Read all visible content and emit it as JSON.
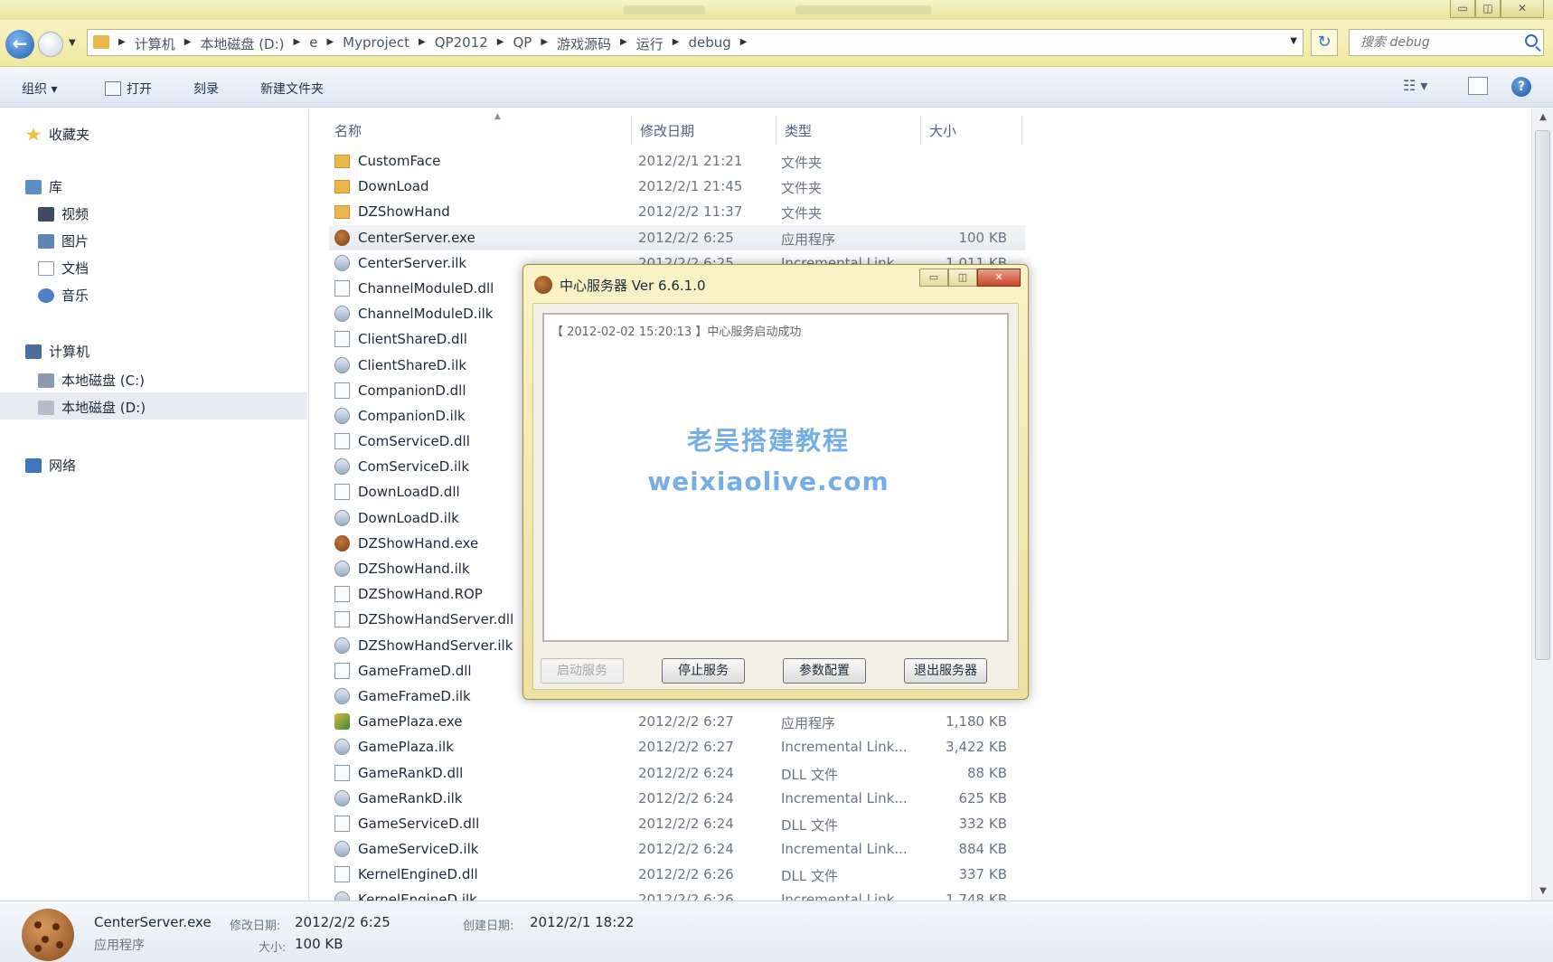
{
  "window": {
    "min": "▭",
    "max": "◫",
    "close": "✕"
  },
  "address": {
    "breadcrumbs": [
      "计算机",
      "本地磁盘 (D:)",
      "e",
      "Myproject",
      "QP2012",
      "QP",
      "游戏源码",
      "运行",
      "debug"
    ],
    "search_placeholder": "搜索 debug"
  },
  "toolbar": {
    "organize": "组织 ▾",
    "open": "打开",
    "burn": "刻录",
    "new_folder": "新建文件夹",
    "view": "☷ ▾",
    "help": "?"
  },
  "nav": {
    "favorites": "收藏夹",
    "libraries": "库",
    "lib_items": [
      "视频",
      "图片",
      "文档",
      "音乐"
    ],
    "computer": "计算机",
    "drives": [
      "本地磁盘 (C:)",
      "本地磁盘 (D:)"
    ],
    "network": "网络"
  },
  "columns": {
    "name": "名称",
    "date": "修改日期",
    "type": "类型",
    "size": "大小"
  },
  "files": [
    {
      "name": "CustomFace",
      "date": "2012/2/1 21:21",
      "type": "文件夹",
      "size": "",
      "icon": "folder-icon"
    },
    {
      "name": "DownLoad",
      "date": "2012/2/1 21:45",
      "type": "文件夹",
      "size": "",
      "icon": "folder-icon"
    },
    {
      "name": "DZShowHand",
      "date": "2012/2/2 11:37",
      "type": "文件夹",
      "size": "",
      "icon": "folder-icon"
    },
    {
      "name": "CenterServer.exe",
      "date": "2012/2/2 6:25",
      "type": "应用程序",
      "size": "100 KB",
      "icon": "exe-icon"
    },
    {
      "name": "CenterServer.ilk",
      "date": "2012/2/2 6:25",
      "type": "Incremental Link...",
      "size": "1,011 KB",
      "icon": "ilk-file-icon"
    },
    {
      "name": "ChannelModuleD.dll",
      "date": "",
      "type": "",
      "size": "",
      "icon": "dll-file-icon"
    },
    {
      "name": "ChannelModuleD.ilk",
      "date": "",
      "type": "",
      "size": "",
      "icon": "ilk-file-icon"
    },
    {
      "name": "ClientShareD.dll",
      "date": "",
      "type": "",
      "size": "",
      "icon": "dll-file-icon"
    },
    {
      "name": "ClientShareD.ilk",
      "date": "",
      "type": "",
      "size": "",
      "icon": "ilk-file-icon"
    },
    {
      "name": "CompanionD.dll",
      "date": "",
      "type": "",
      "size": "",
      "icon": "dll-file-icon"
    },
    {
      "name": "CompanionD.ilk",
      "date": "",
      "type": "",
      "size": "",
      "icon": "ilk-file-icon"
    },
    {
      "name": "ComServiceD.dll",
      "date": "",
      "type": "",
      "size": "",
      "icon": "dll-file-icon"
    },
    {
      "name": "ComServiceD.ilk",
      "date": "",
      "type": "",
      "size": "",
      "icon": "ilk-file-icon"
    },
    {
      "name": "DownLoadD.dll",
      "date": "",
      "type": "",
      "size": "",
      "icon": "dll-file-icon"
    },
    {
      "name": "DownLoadD.ilk",
      "date": "",
      "type": "",
      "size": "",
      "icon": "ilk-file-icon"
    },
    {
      "name": "DZShowHand.exe",
      "date": "",
      "type": "",
      "size": "",
      "icon": "exe-icon"
    },
    {
      "name": "DZShowHand.ilk",
      "date": "",
      "type": "",
      "size": "",
      "icon": "ilk-file-icon"
    },
    {
      "name": "DZShowHand.ROP",
      "date": "",
      "type": "",
      "size": "",
      "icon": "blank-file-icon"
    },
    {
      "name": "DZShowHandServer.dll",
      "date": "",
      "type": "",
      "size": "",
      "icon": "dll-file-icon"
    },
    {
      "name": "DZShowHandServer.ilk",
      "date": "",
      "type": "",
      "size": "",
      "icon": "ilk-file-icon"
    },
    {
      "name": "GameFrameD.dll",
      "date": "",
      "type": "",
      "size": "",
      "icon": "dll-file-icon"
    },
    {
      "name": "GameFrameD.ilk",
      "date": "",
      "type": "",
      "size": "",
      "icon": "ilk-file-icon"
    },
    {
      "name": "GamePlaza.exe",
      "date": "2012/2/2 6:27",
      "type": "应用程序",
      "size": "1,180 KB",
      "icon": "plaza-exe-icon"
    },
    {
      "name": "GamePlaza.ilk",
      "date": "2012/2/2 6:27",
      "type": "Incremental Link...",
      "size": "3,422 KB",
      "icon": "ilk-file-icon"
    },
    {
      "name": "GameRankD.dll",
      "date": "2012/2/2 6:24",
      "type": "DLL 文件",
      "size": "88 KB",
      "icon": "dll-file-icon"
    },
    {
      "name": "GameRankD.ilk",
      "date": "2012/2/2 6:24",
      "type": "Incremental Link...",
      "size": "625 KB",
      "icon": "ilk-file-icon"
    },
    {
      "name": "GameServiceD.dll",
      "date": "2012/2/2 6:24",
      "type": "DLL 文件",
      "size": "332 KB",
      "icon": "dll-file-icon"
    },
    {
      "name": "GameServiceD.ilk",
      "date": "2012/2/2 6:24",
      "type": "Incremental Link...",
      "size": "884 KB",
      "icon": "ilk-file-icon"
    },
    {
      "name": "KernelEngineD.dll",
      "date": "2012/2/2 6:26",
      "type": "DLL 文件",
      "size": "337 KB",
      "icon": "dll-file-icon"
    },
    {
      "name": "KernelEngineD.ilk",
      "date": "2012/2/2 6:26",
      "type": "Incremental Link...",
      "size": "1,748 KB",
      "icon": "ilk-file-icon"
    }
  ],
  "details": {
    "filename": "CenterServer.exe",
    "filetype": "应用程序",
    "modified_label": "修改日期:",
    "modified": "2012/2/2 6:25",
    "size_label": "大小:",
    "size": "100 KB",
    "created_label": "创建日期:",
    "created": "2012/2/1 18:22"
  },
  "dialog": {
    "title": "中心服务器 Ver 6.6.1.0",
    "log": "【 2012-02-02  15:20:13 】中心服务启动成功",
    "buttons": [
      "启动服务",
      "停止服务",
      "参数配置",
      "退出服务器"
    ]
  },
  "watermark": {
    "line1": "老吴搭建教程",
    "line2": "weixiaolive.com"
  },
  "colors": {
    "accent": "#1f5fb4",
    "titlebar": "#ece6a6",
    "watermark": "#5ea1e3"
  }
}
